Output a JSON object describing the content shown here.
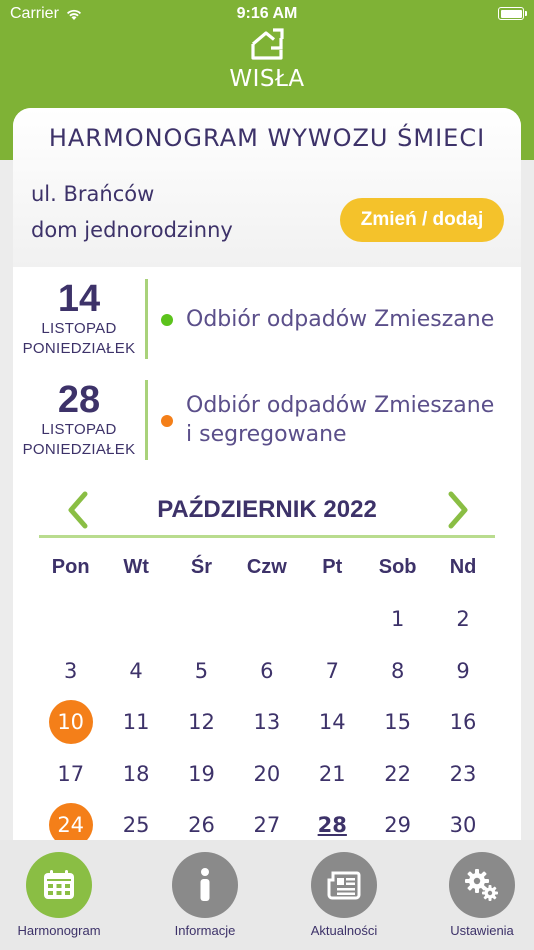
{
  "status_bar": {
    "carrier": "Carrier",
    "time": "9:16 AM"
  },
  "logo": {
    "name": "WISŁA",
    "icon": "home-arrow-icon"
  },
  "card": {
    "title": "HARMONOGRAM WYWOZU ŚMIECI",
    "address_line1": "ul. Brańców",
    "address_line2": "dom jednorodzinny",
    "change_button": "Zmień / dodaj"
  },
  "events": [
    {
      "day": "14",
      "month": "LISTOPAD",
      "weekday": "PONIEDZIAŁEK",
      "text": "Odbiór odpadów Zmieszane",
      "dot_color": "#5cc31c"
    },
    {
      "day": "28",
      "month": "LISTOPAD",
      "weekday": "PONIEDZIAŁEK",
      "text": "Odbiór odpadów Zmieszane i segregowane",
      "dot_color": "#f47f19"
    }
  ],
  "calendar": {
    "month_title": "PAŹDZIERNIK 2022",
    "weekdays": [
      "Pon",
      "Wt",
      "Śr",
      "Czw",
      "Pt",
      "Sob",
      "Nd"
    ],
    "weeks": [
      [
        "",
        "",
        "",
        "",
        "",
        "1",
        "2"
      ],
      [
        "3",
        "4",
        "5",
        "6",
        "7",
        "8",
        "9"
      ],
      [
        "10",
        "11",
        "12",
        "13",
        "14",
        "15",
        "16"
      ],
      [
        "17",
        "18",
        "19",
        "20",
        "21",
        "22",
        "23"
      ],
      [
        "24",
        "25",
        "26",
        "27",
        "28",
        "29",
        "30"
      ]
    ],
    "highlighted_days": [
      "10",
      "24"
    ],
    "today": "28",
    "accent_color": "#f47f19"
  },
  "tabs": [
    {
      "label": "Harmonogram",
      "icon": "calendar-icon",
      "active": true
    },
    {
      "label": "Informacje",
      "icon": "info-icon",
      "active": false
    },
    {
      "label": "Aktualności",
      "icon": "news-icon",
      "active": false
    },
    {
      "label": "Ustawienia",
      "icon": "gears-icon",
      "active": false
    }
  ]
}
